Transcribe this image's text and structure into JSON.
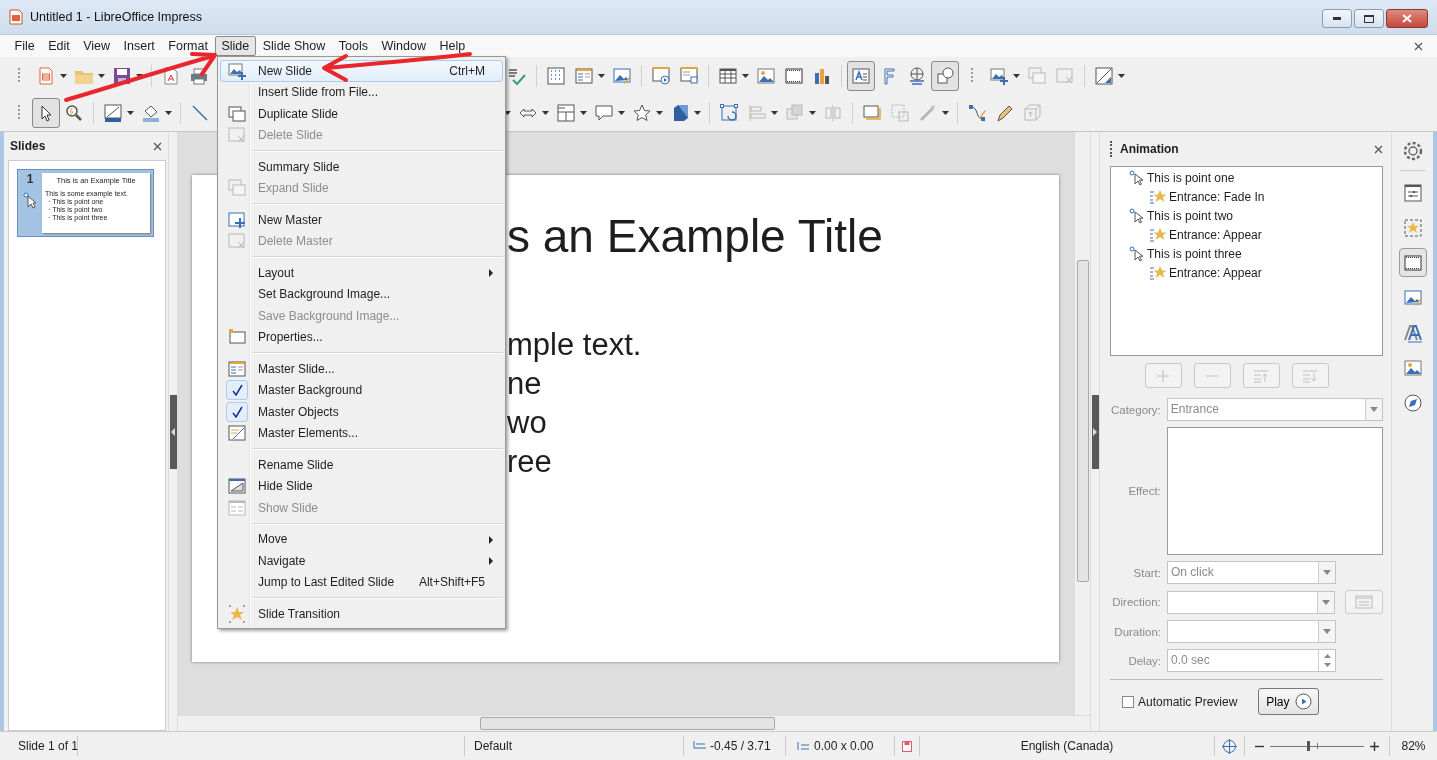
{
  "window": {
    "title": "Untitled 1 - LibreOffice Impress"
  },
  "menubar": {
    "items": [
      {
        "label": "File",
        "selected": false
      },
      {
        "label": "Edit",
        "selected": false
      },
      {
        "label": "View",
        "selected": false
      },
      {
        "label": "Insert",
        "selected": false
      },
      {
        "label": "Format",
        "selected": false
      },
      {
        "label": "Slide",
        "selected": true
      },
      {
        "label": "Slide Show",
        "selected": false
      },
      {
        "label": "Tools",
        "selected": false
      },
      {
        "label": "Window",
        "selected": false
      },
      {
        "label": "Help",
        "selected": false
      }
    ]
  },
  "toolbars": {
    "select": {
      "on": true
    },
    "text_box": {
      "on": true
    },
    "basic_shapes": {
      "on": true
    }
  },
  "slides_panel": {
    "title": "Slides",
    "thumbnails": [
      {
        "number": "1",
        "selected": true,
        "title": "This is an Example Title",
        "lines": [
          "This is some example text.",
          "· This is point one",
          "· This is point two",
          "· This is point three"
        ]
      }
    ]
  },
  "slide": {
    "texts": [
      {
        "kind": "title",
        "text": "s an Example Title"
      },
      {
        "kind": "body",
        "text": "mple text."
      },
      {
        "kind": "body",
        "text": "ne"
      },
      {
        "kind": "body",
        "text": "wo"
      },
      {
        "kind": "body",
        "text": "ree"
      }
    ]
  },
  "slide_menu": {
    "groups": [
      [
        {
          "label": "New Slide",
          "shortcut": "Ctrl+M",
          "selected": true,
          "disabled": false,
          "checked": false,
          "submenu": false
        },
        {
          "label": "Insert Slide from File...",
          "selected": false,
          "disabled": false,
          "checked": false,
          "submenu": false
        },
        {
          "label": "Duplicate Slide",
          "selected": false,
          "disabled": false,
          "checked": false,
          "submenu": false
        },
        {
          "label": "Delete Slide",
          "selected": false,
          "disabled": true,
          "checked": false,
          "submenu": false
        }
      ],
      [
        {
          "label": "Summary Slide",
          "selected": false,
          "disabled": false,
          "checked": false,
          "submenu": false
        },
        {
          "label": "Expand Slide",
          "selected": false,
          "disabled": true,
          "checked": false,
          "submenu": false
        }
      ],
      [
        {
          "label": "New Master",
          "selected": false,
          "disabled": false,
          "checked": false,
          "submenu": false
        },
        {
          "label": "Delete Master",
          "selected": false,
          "disabled": true,
          "checked": false,
          "submenu": false
        }
      ],
      [
        {
          "label": "Layout",
          "selected": false,
          "disabled": false,
          "checked": false,
          "submenu": true
        },
        {
          "label": "Set Background Image...",
          "selected": false,
          "disabled": false,
          "checked": false,
          "submenu": false
        },
        {
          "label": "Save Background Image...",
          "selected": false,
          "disabled": true,
          "checked": false,
          "submenu": false
        },
        {
          "label": "Properties...",
          "selected": false,
          "disabled": false,
          "checked": false,
          "submenu": false
        }
      ],
      [
        {
          "label": "Master Slide...",
          "selected": false,
          "disabled": false,
          "checked": false,
          "submenu": false
        },
        {
          "label": "Master Background",
          "selected": false,
          "disabled": false,
          "checked": true,
          "submenu": false
        },
        {
          "label": "Master Objects",
          "selected": false,
          "disabled": false,
          "checked": true,
          "submenu": false
        },
        {
          "label": "Master Elements...",
          "selected": false,
          "disabled": false,
          "checked": false,
          "submenu": false
        }
      ],
      [
        {
          "label": "Rename Slide",
          "selected": false,
          "disabled": false,
          "checked": false,
          "submenu": false
        },
        {
          "label": "Hide Slide",
          "selected": false,
          "disabled": false,
          "checked": false,
          "submenu": false
        },
        {
          "label": "Show Slide",
          "selected": false,
          "disabled": true,
          "checked": false,
          "submenu": false
        }
      ],
      [
        {
          "label": "Move",
          "selected": false,
          "disabled": false,
          "checked": false,
          "submenu": true
        },
        {
          "label": "Navigate",
          "selected": false,
          "disabled": false,
          "checked": false,
          "submenu": true
        },
        {
          "label": "Jump to Last Edited Slide",
          "shortcut": "Alt+Shift+F5",
          "selected": false,
          "disabled": false,
          "checked": false,
          "submenu": false
        }
      ],
      [
        {
          "label": "Slide Transition",
          "selected": false,
          "disabled": false,
          "checked": false,
          "submenu": false
        }
      ]
    ]
  },
  "animation_panel": {
    "title": "Animation",
    "tree": [
      {
        "label": "This is point one",
        "children": [
          {
            "label": "Entrance: Fade In"
          }
        ]
      },
      {
        "label": "This is point two",
        "children": [
          {
            "label": "Entrance: Appear"
          }
        ]
      },
      {
        "label": "This is point three",
        "children": [
          {
            "label": "Entrance: Appear"
          }
        ]
      }
    ],
    "list_buttons": [
      {
        "disabled": true
      },
      {
        "disabled": true
      },
      {
        "disabled": true
      },
      {
        "disabled": true
      }
    ],
    "category": {
      "label": "Category:",
      "value": "Entrance",
      "disabled": true
    },
    "effect": {
      "label": "Effect:",
      "disabled": true
    },
    "start": {
      "label": "Start:",
      "value": "On click",
      "disabled": true
    },
    "direction": {
      "label": "Direction:",
      "disabled": true
    },
    "duration": {
      "label": "Duration:",
      "disabled": true
    },
    "delay": {
      "label": "Delay:",
      "value": "0.0 sec",
      "disabled": true
    },
    "automatic_preview": {
      "label": "Automatic Preview",
      "checked": false
    },
    "play": {
      "label": "Play"
    }
  },
  "deck_tabs": [
    {
      "selected": false
    },
    {
      "selected": false
    },
    {
      "selected": true
    },
    {
      "selected": false
    },
    {
      "selected": false
    },
    {
      "selected": false
    },
    {
      "selected": false
    }
  ],
  "status_bar": {
    "slide": "Slide 1 of 1",
    "master": "Default",
    "position": "-0.45 / 3.71",
    "size": "0.00 x 0.00",
    "language": "English (Canada)",
    "zoom": {
      "level": 0.4,
      "reading": "82%"
    }
  }
}
